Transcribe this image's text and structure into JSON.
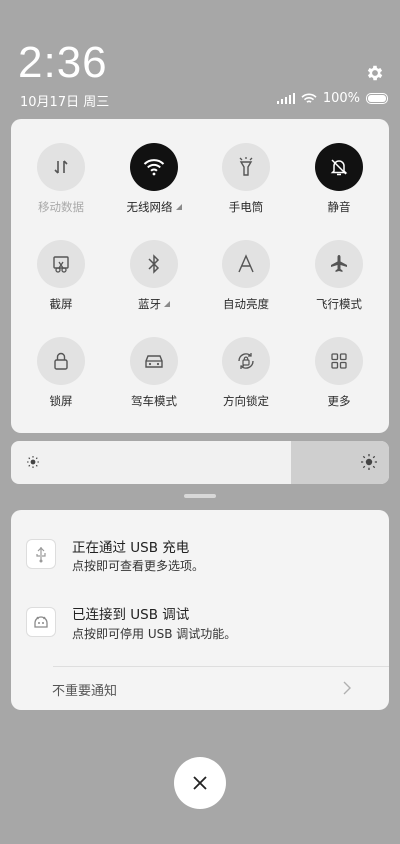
{
  "status": {
    "time": "2:36",
    "date": "10月17日 周三",
    "battery_percent": "100%"
  },
  "quick_settings": {
    "tiles": [
      {
        "label": "移动数据",
        "icon": "mobile-data-icon",
        "state": "disabled"
      },
      {
        "label": "无线网络",
        "icon": "wifi-icon",
        "state": "on",
        "has_more": true
      },
      {
        "label": "手电筒",
        "icon": "flashlight-icon",
        "state": "off"
      },
      {
        "label": "静音",
        "icon": "mute-bell-icon",
        "state": "on"
      },
      {
        "label": "截屏",
        "icon": "screenshot-icon",
        "state": "off"
      },
      {
        "label": "蓝牙",
        "icon": "bluetooth-icon",
        "state": "off",
        "has_more": true
      },
      {
        "label": "自动亮度",
        "icon": "auto-brightness-icon",
        "state": "off"
      },
      {
        "label": "飞行模式",
        "icon": "airplane-icon",
        "state": "off"
      },
      {
        "label": "锁屏",
        "icon": "lock-icon",
        "state": "off"
      },
      {
        "label": "驾车模式",
        "icon": "car-icon",
        "state": "off"
      },
      {
        "label": "方向锁定",
        "icon": "rotation-lock-icon",
        "state": "off"
      },
      {
        "label": "更多",
        "icon": "grid-icon",
        "state": "off"
      }
    ]
  },
  "brightness": {
    "level": 0.74
  },
  "notifications": [
    {
      "title": "正在通过 USB 充电",
      "subtitle": "点按即可查看更多选项。",
      "icon": "android-usb-icon"
    },
    {
      "title": "已连接到 USB 调试",
      "subtitle": "点按即可停用 USB 调试功能。",
      "icon": "android-debug-icon"
    }
  ],
  "unimportant_label": "不重要通知",
  "colors": {
    "background": "#a7a7a7",
    "tile_on": "#111111",
    "tile_off": "#e2e2e2"
  }
}
